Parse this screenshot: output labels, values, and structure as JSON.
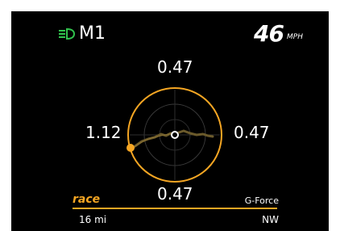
{
  "colors": {
    "accent": "#f5a623",
    "indicator_green": "#31c24d",
    "background": "#000000",
    "text": "#ffffff"
  },
  "header": {
    "headlight_icon": "headlight-indicator-icon",
    "mode": "M1",
    "speed": "46",
    "speed_unit": "MPH"
  },
  "gforce": {
    "top": "0.47",
    "left": "1.12",
    "right": "0.47",
    "bottom": "0.47",
    "marker": {
      "x": -0.95,
      "y": -0.28
    }
  },
  "footer": {
    "drive_mode": "race",
    "screen_name": "G-Force",
    "odometer": "16 mi",
    "heading": "NW"
  }
}
